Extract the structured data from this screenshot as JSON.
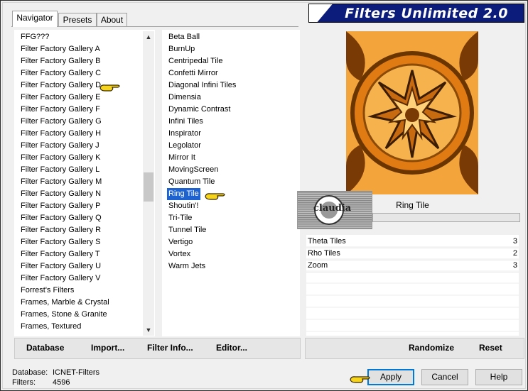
{
  "banner": {
    "title": "Filters Unlimited 2.0"
  },
  "tabs": [
    {
      "label": "Navigator",
      "active": true
    },
    {
      "label": "Presets",
      "active": false
    },
    {
      "label": "About",
      "active": false
    }
  ],
  "categories": [
    "FFG???",
    "Filter Factory Gallery A",
    "Filter Factory Gallery B",
    "Filter Factory Gallery C",
    "Filter Factory Gallery D",
    "Filter Factory Gallery E",
    "Filter Factory Gallery F",
    "Filter Factory Gallery G",
    "Filter Factory Gallery H",
    "Filter Factory Gallery J",
    "Filter Factory Gallery K",
    "Filter Factory Gallery L",
    "Filter Factory Gallery M",
    "Filter Factory Gallery N",
    "Filter Factory Gallery P",
    "Filter Factory Gallery Q",
    "Filter Factory Gallery R",
    "Filter Factory Gallery S",
    "Filter Factory Gallery T",
    "Filter Factory Gallery U",
    "Filter Factory Gallery V",
    "Forrest's Filters",
    "Frames, Marble & Crystal",
    "Frames, Stone & Granite",
    "Frames, Textured"
  ],
  "filters": [
    "Beta Ball",
    "BurnUp",
    "Centripedal Tile",
    "Confetti Mirror",
    "Diagonal Infini Tiles",
    "Dimensia",
    "Dynamic Contrast",
    "Infini Tiles",
    "Inspirator",
    "Legolator",
    "Mirror It",
    "MovingScreen",
    "Quantum Tile",
    "Ring Tile",
    "Shoutin'!",
    "Tri-Tile",
    "Tunnel Tile",
    "Vertigo",
    "Vortex",
    "Warm Jets"
  ],
  "selected_filter": "Ring Tile",
  "selected_filter_label": "Ring Tile",
  "watermark_text": "claudia",
  "params": [
    {
      "name": "Theta Tiles",
      "value": "3"
    },
    {
      "name": "Rho Tiles",
      "value": "2"
    },
    {
      "name": "Zoom",
      "value": "3"
    }
  ],
  "toolbar": {
    "database": "Database",
    "import": "Import...",
    "filter_info": "Filter Info...",
    "editor": "Editor...",
    "randomize": "Randomize",
    "reset": "Reset"
  },
  "status": {
    "database_label": "Database:",
    "database_value": "ICNET-Filters",
    "filters_label": "Filters:",
    "filters_value": "4596"
  },
  "buttons": {
    "apply": "Apply",
    "cancel": "Cancel",
    "help": "Help"
  },
  "colors": {
    "banner": "#0b1c7a",
    "selection": "#1e62d0",
    "preview_bg": "#f2a33a",
    "pointer": "#f6d31c"
  }
}
